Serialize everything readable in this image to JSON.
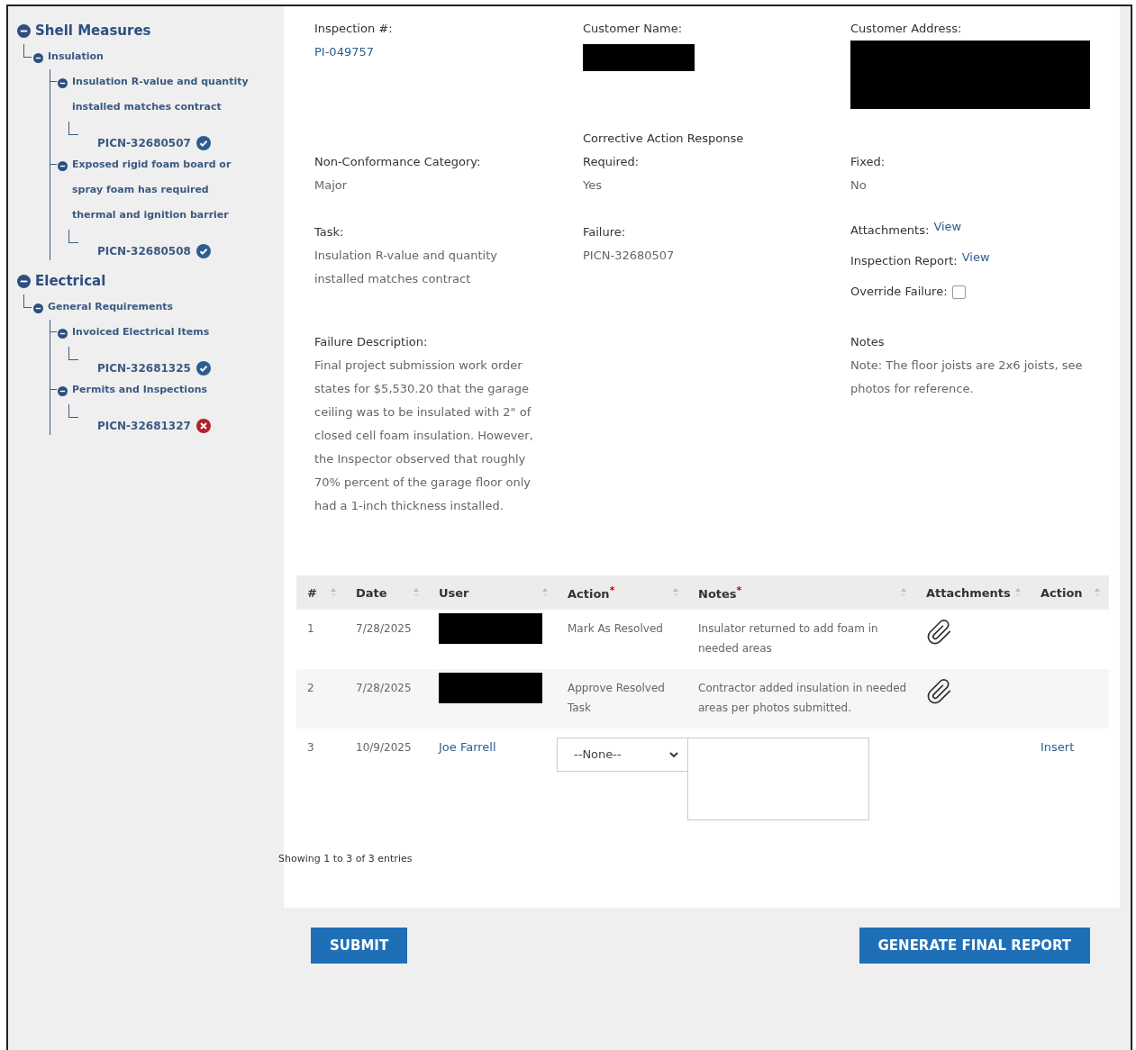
{
  "tree": [
    {
      "label": "Shell Measures",
      "children": [
        {
          "label": "Insulation",
          "children": [
            {
              "label": "Insulation R-value and quantity installed matches contract",
              "children": [
                {
                  "label": "PICN-32680507",
                  "passed": true
                }
              ]
            },
            {
              "label": "Exposed rigid foam board or spray foam has required thermal and ignition barrier",
              "children": [
                {
                  "label": "PICN-32680508",
                  "passed": true
                }
              ]
            }
          ]
        }
      ]
    },
    {
      "label": "Electrical",
      "children": [
        {
          "label": "General Requirements",
          "children": [
            {
              "label": "Invoiced Electrical Items",
              "children": [
                {
                  "label": "PICN-32681325",
                  "passed": true
                }
              ]
            },
            {
              "label": "Permits and Inspections",
              "children": [
                {
                  "label": "PICN-32681327",
                  "passed": false
                }
              ]
            }
          ]
        }
      ]
    }
  ],
  "details": [
    [
      {
        "label": "Inspection #:",
        "kind": "link",
        "value": "PI-049757"
      },
      {
        "label": "Customer Name:",
        "kind": "redacted"
      },
      {
        "label": "Customer Address:",
        "kind": "redacted"
      }
    ],
    [
      {
        "label": "Non-Conformance Category:",
        "kind": "text",
        "value": "Major"
      },
      {
        "label": "Corrective Action Response Required:",
        "kind": "text",
        "value": "Yes"
      },
      {
        "label": "Fixed:",
        "kind": "text",
        "value": "No"
      }
    ],
    [
      {
        "label": "Task:",
        "kind": "text",
        "value": "Insulation R-value and quantity installed matches contract"
      },
      {
        "label": "Failure:",
        "kind": "text",
        "value": "PICN-32680507"
      },
      {
        "kind": "extras",
        "links": [
          {
            "label": "Attachments:",
            "link": "View"
          },
          {
            "label": "Inspection Report:",
            "link": "View"
          }
        ],
        "override": {
          "label": "Override Failure:",
          "checked": false
        }
      }
    ],
    [
      {
        "label": "Failure Description:",
        "kind": "text",
        "value": "Final project submission work order states for $5,530.20 that the garage ceiling was to be insulated with 2\" of closed cell foam insulation. However, the Inspector observed that roughly 70% percent of the garage floor only had a 1-inch thickness installed."
      },
      {
        "kind": "empty"
      },
      {
        "label": "Notes",
        "kind": "text",
        "value": "Note: The floor joists are 2x6 joists, see photos for reference."
      }
    ]
  ],
  "table": {
    "columns": [
      {
        "label": "#"
      },
      {
        "label": "Date"
      },
      {
        "label": "User"
      },
      {
        "label": "Action",
        "marker": "*"
      },
      {
        "label": "Notes",
        "marker": "*"
      },
      {
        "label": "Attachments"
      },
      {
        "label": "Action"
      }
    ],
    "rows": [
      {
        "kind": "entry",
        "number": "1",
        "date": "7/28/2025",
        "action": "Mark As Resolved",
        "notes": "Insulator returned to add foam in needed areas",
        "attachment": true
      },
      {
        "kind": "entry",
        "number": "2",
        "date": "7/28/2025",
        "action": "Approve Resolved Task",
        "notes": "Contractor added insulation in needed areas per photos submitted.",
        "attachment": true
      },
      {
        "kind": "new",
        "number": "3",
        "date": "10/9/2025",
        "user": "Joe Farrell",
        "action_select": "--None--",
        "insert": "Insert"
      }
    ],
    "info": "Showing 1 to 3 of 3 entries"
  },
  "buttons": [
    {
      "label": "SUBMIT"
    },
    {
      "label": "GENERATE FINAL REPORT"
    }
  ]
}
